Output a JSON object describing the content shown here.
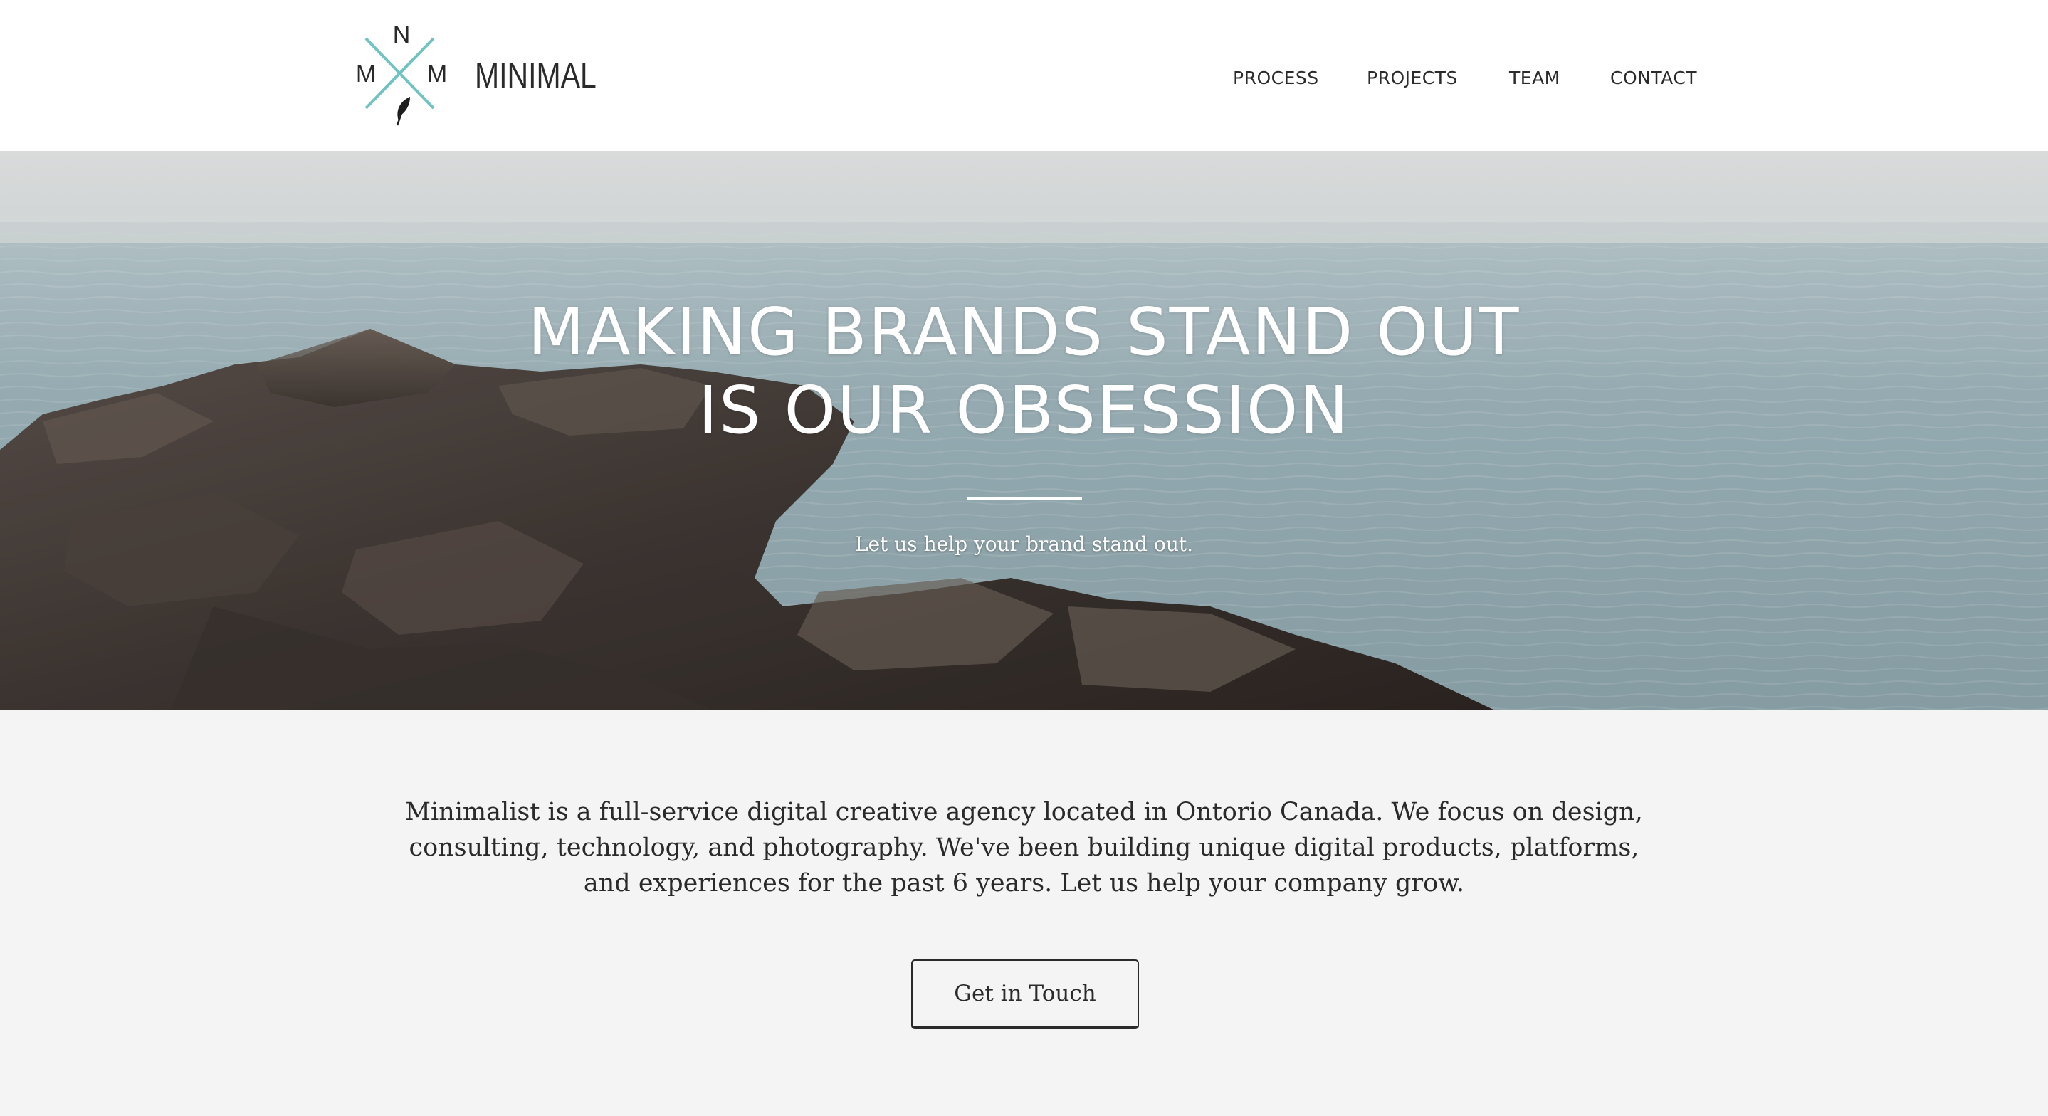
{
  "brand": {
    "name": "MINIMAL",
    "logo_letters": {
      "top": "N",
      "left": "M",
      "right": "M"
    },
    "logo_icon": "feather-icon",
    "accent_color": "#6fc3c3"
  },
  "nav": {
    "items": [
      {
        "label": "PROCESS"
      },
      {
        "label": "PROJECTS"
      },
      {
        "label": "TEAM"
      },
      {
        "label": "CONTACT"
      }
    ]
  },
  "hero": {
    "title_line1": "MAKING BRANDS STAND OUT",
    "title_line2": "IS OUR OBSESSION",
    "subtitle": "Let us help your brand stand out."
  },
  "about": {
    "text": "Minimalist is a full-service digital creative agency located in Ontorio Canada. We focus on design, consulting, technology, and photography. We've been building unique digital products, platforms, and experiences for the past 6 years. Let us help your company grow.",
    "cta_label": "Get in Touch"
  }
}
